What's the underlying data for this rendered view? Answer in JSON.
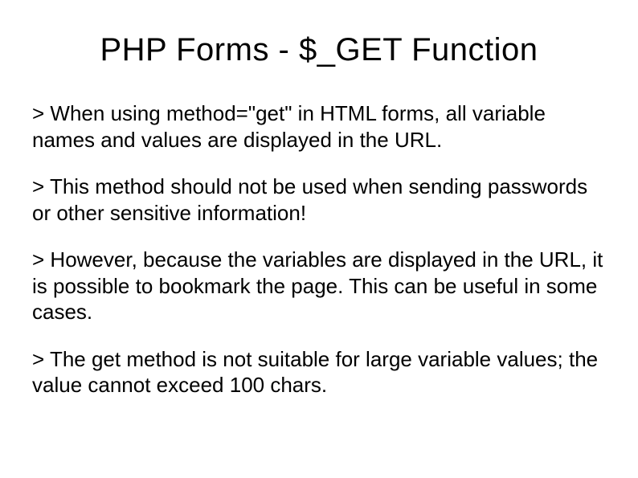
{
  "slide": {
    "title": "PHP Forms - $_GET Function",
    "bullets": [
      "When using method=\"get\" in HTML forms, all variable names and values are displayed in the URL.",
      "This method should not be used when sending passwords or other sensitive information!",
      "However, because the variables are displayed in the URL, it is possible to bookmark the page. This can be useful in some cases.",
      "The get method is not suitable for large variable values; the value cannot exceed 100 chars."
    ],
    "marker": "> "
  }
}
